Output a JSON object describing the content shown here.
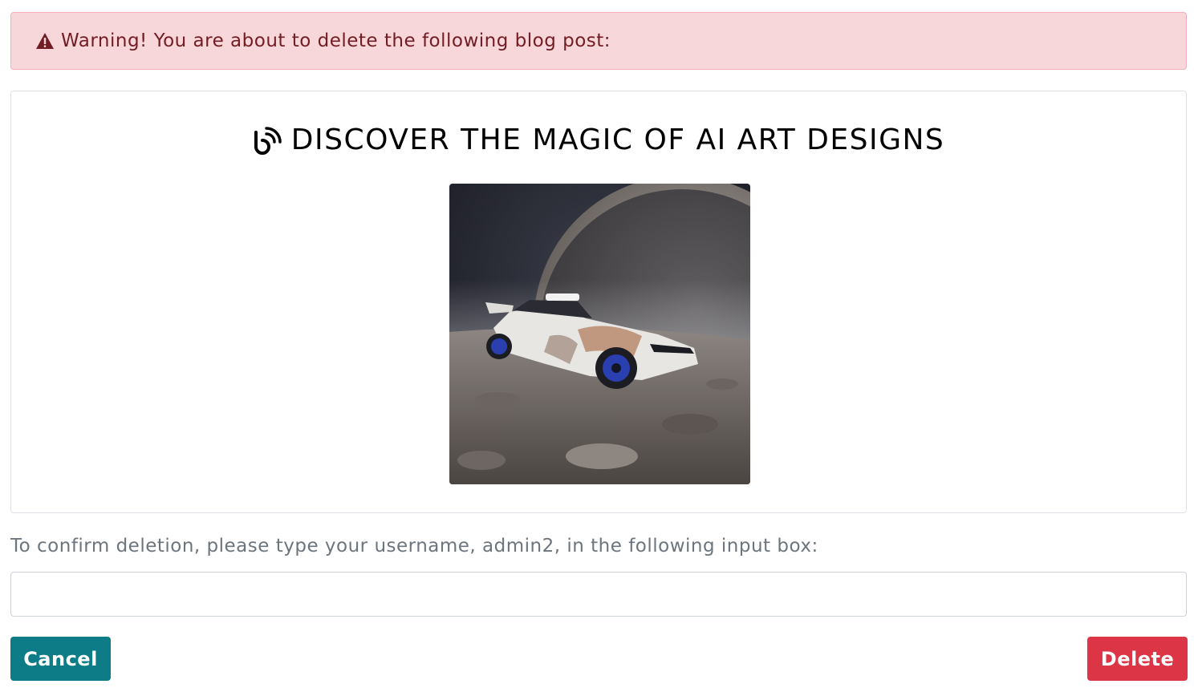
{
  "alert": {
    "text": "Warning! You are about to delete the following blog post:",
    "icon": "warning-triangle-icon",
    "color": "#721c24",
    "background": "#f8d7da"
  },
  "post": {
    "title": "DISCOVER THE MAGIC OF AI ART DESIGNS",
    "icon": "blog-icon",
    "image_alt": "white sports car on moon surface with planet in sky"
  },
  "confirm": {
    "label": "To confirm deletion, please type your username, admin2, in the following input box:",
    "input_value": "",
    "input_placeholder": ""
  },
  "buttons": {
    "cancel_label": "Cancel",
    "delete_label": "Delete",
    "cancel_color": "#0e7c86",
    "delete_color": "#dc3545"
  }
}
